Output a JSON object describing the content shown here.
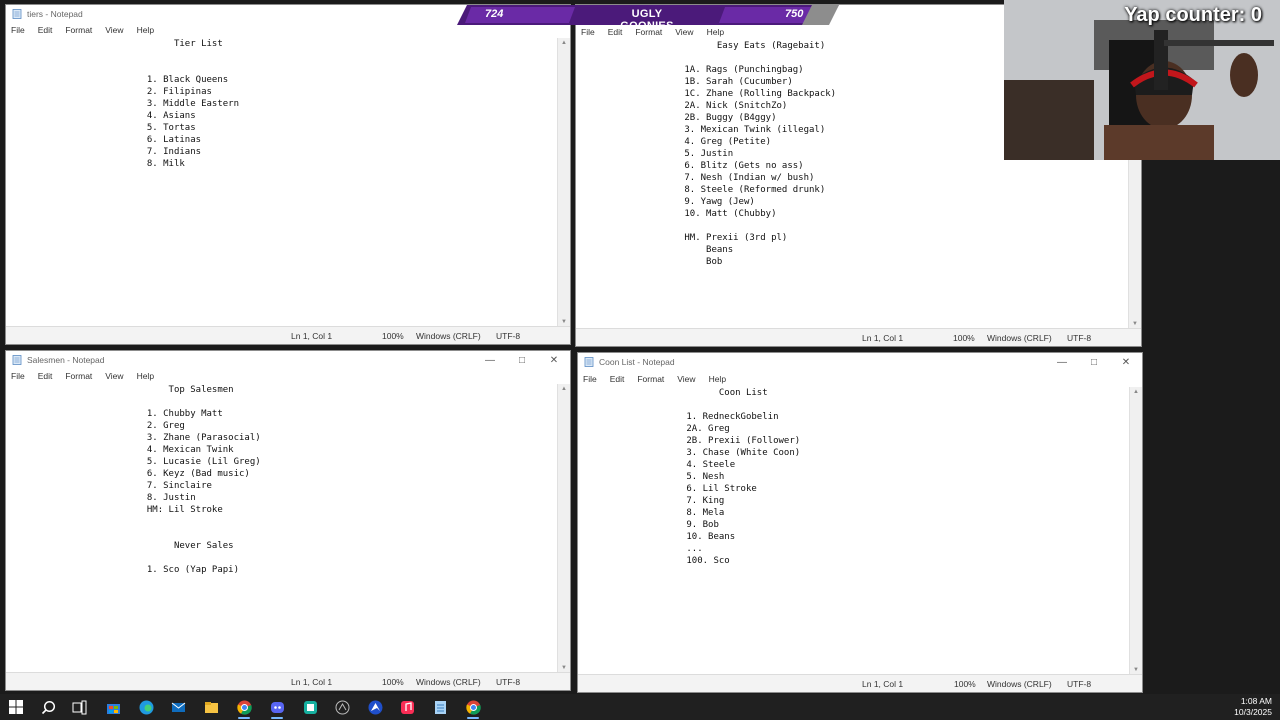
{
  "banner": {
    "left_score": "724",
    "team_name": "UGLY GOONIES",
    "right_score": "750"
  },
  "webcam": {
    "yap_counter": "Yap counter: 0"
  },
  "menu": [
    "File",
    "Edit",
    "Format",
    "View",
    "Help"
  ],
  "windows": [
    {
      "title": "tiers - Notepad",
      "content": "                               Tier List\n\n\n                          1. Black Queens\n                          2. Filipinas\n                          3. Middle Eastern\n                          4. Asians\n                          5. Tortas\n                          6. Latinas\n                          7. Indians\n                          8. Milk",
      "status": {
        "position": "Ln 1, Col 1",
        "zoom": "100%",
        "eol": "Windows (CRLF)",
        "encoding": "UTF-8"
      }
    },
    {
      "title": "",
      "content": "                          Easy Eats (Ragebait)\n\n                    1A. Rags (Punchingbag)\n                    1B. Sarah (Cucumber)\n                    1C. Zhane (Rolling Backpack)\n                    2A. Nick (SnitchZo)\n                    2B. Buggy (B4ggy)\n                    3. Mexican Twink (illegal)\n                    4. Greg (Petite)\n                    5. Justin\n                    6. Blitz (Gets no ass)\n                    7. Nesh (Indian w/ bush)\n                    8. Steele (Reformed drunk)\n                    9. Yawg (Jew)\n                    10. Matt (Chubby)\n\n                    HM. Prexii (3rd pl)\n                        Beans\n                        Bob",
      "status": {
        "position": "Ln 1, Col 1",
        "zoom": "100%",
        "eol": "Windows (CRLF)",
        "encoding": "UTF-8"
      }
    },
    {
      "title": "Salesmen - Notepad",
      "content": "                              Top Salesmen\n\n                          1. Chubby Matt\n                          2. Greg\n                          3. Zhane (Parasocial)\n                          4. Mexican Twink\n                          5. Lucasie (Lil Greg)\n                          6. Keyz (Bad music)\n                          7. Sinclaire\n                          8. Justin\n                          HM: Lil Stroke\n\n\n                               Never Sales\n\n                          1. Sco (Yap Papi)",
      "status": {
        "position": "Ln 1, Col 1",
        "zoom": "100%",
        "eol": "Windows (CRLF)",
        "encoding": "UTF-8"
      }
    },
    {
      "title": "Coon List - Notepad",
      "content": "                          Coon List\n\n                    1. RedneckGobelin\n                    2A. Greg\n                    2B. Prexii (Follower)\n                    3. Chase (White Coon)\n                    4. Steele\n                    5. Nesh\n                    6. Lil Stroke\n                    7. King\n                    8. Mela\n                    9. Bob\n                    10. Beans\n                    ...\n                    100. Sco",
      "status": {
        "position": "Ln 1, Col 1",
        "zoom": "100%",
        "eol": "Windows (CRLF)",
        "encoding": "UTF-8"
      }
    }
  ],
  "taskbar": {
    "icons": [
      "windows-start-icon",
      "search-icon",
      "task-view-icon",
      "store-icon",
      "edge-icon",
      "mail-icon",
      "file-explorer-icon",
      "chrome-icon",
      "discord-icon",
      "spotify-icon",
      "app-icon",
      "nordvpn-icon",
      "itunes-icon",
      "notepad-icon",
      "chrome-icon"
    ],
    "time": "1:08 AM",
    "date": "10/3/2025"
  }
}
